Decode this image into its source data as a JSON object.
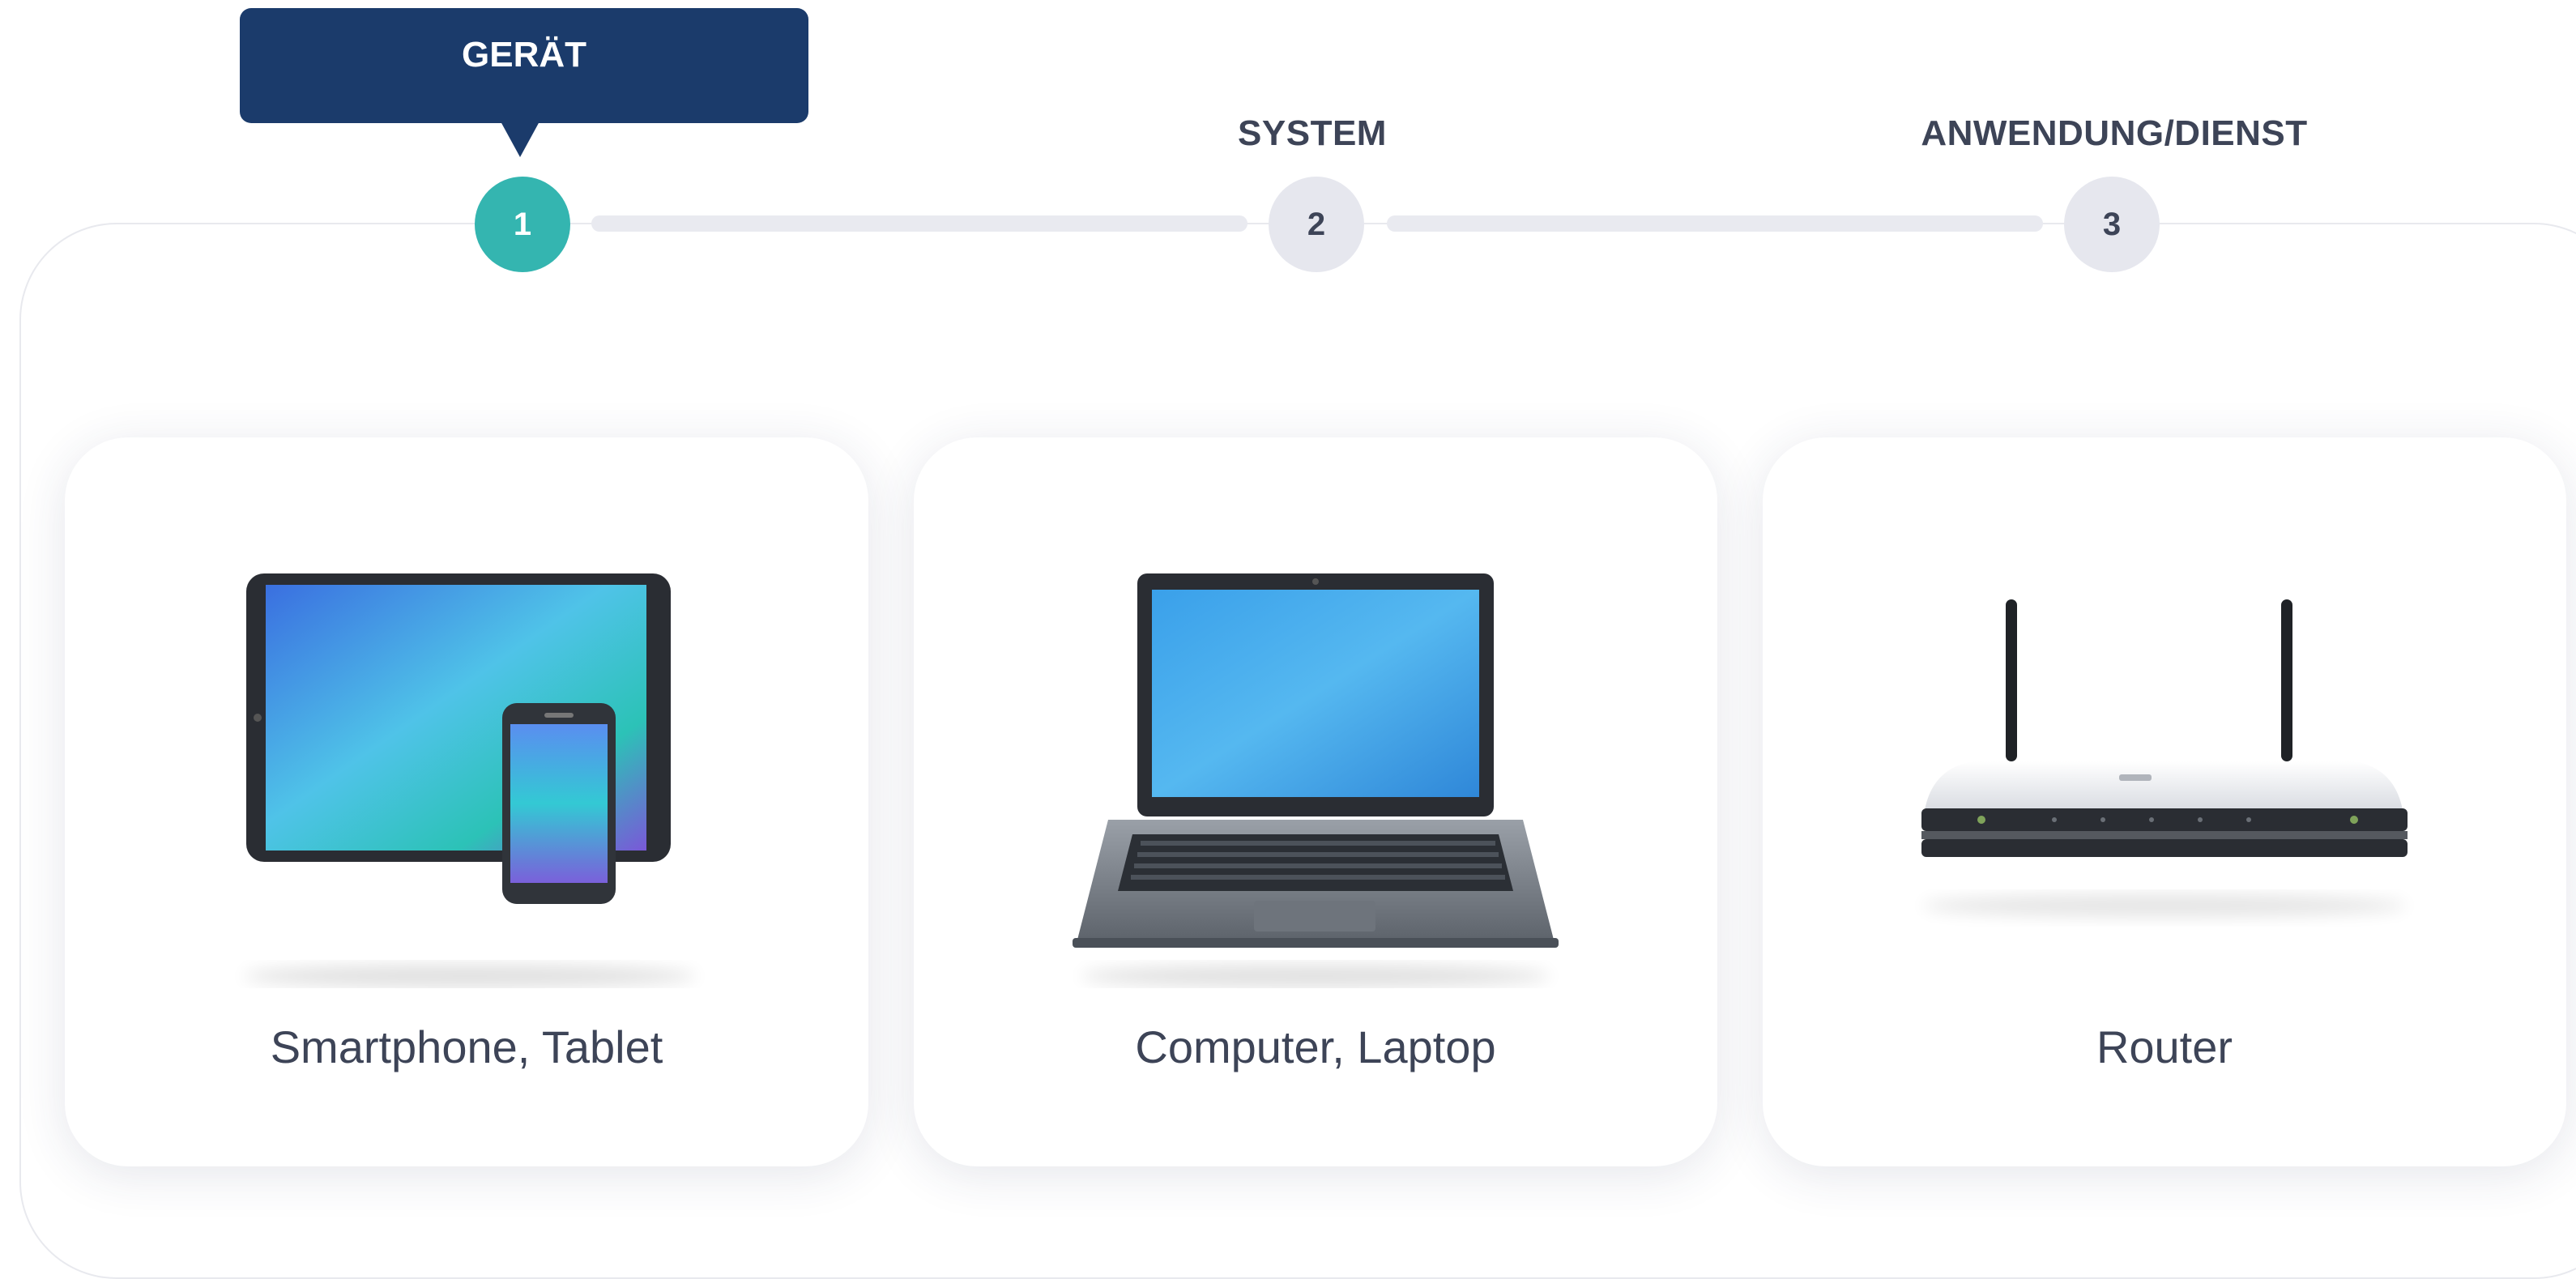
{
  "stepper": {
    "steps": [
      {
        "number": "1",
        "label": "GERÄT",
        "state": "active"
      },
      {
        "number": "2",
        "label": "SYSTEM",
        "state": "inactive"
      },
      {
        "number": "3",
        "label": "ANWENDUNG/DIENST",
        "state": "inactive"
      }
    ]
  },
  "devices": [
    {
      "label": "Smartphone, Tablet",
      "icon": "tablet-smartphone-icon"
    },
    {
      "label": "Computer, Laptop",
      "icon": "laptop-icon"
    },
    {
      "label": "Router",
      "icon": "router-icon"
    }
  ],
  "colors": {
    "accent": "#34b5b0",
    "tooltip": "#1b3b6b",
    "text": "#3d4457",
    "inactive_step": "#e6e7ee"
  }
}
